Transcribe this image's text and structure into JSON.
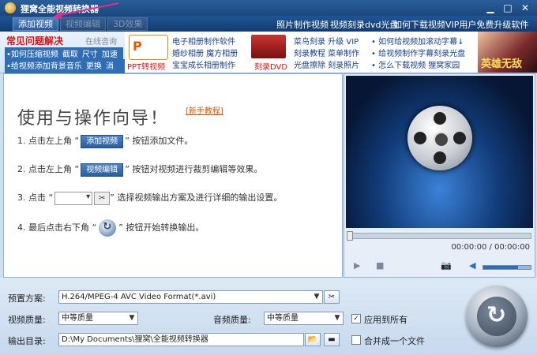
{
  "window": {
    "title": "狸窝全能视频转换器"
  },
  "toolbar": {
    "add_video": "添加视频",
    "edit_video": "视频编辑",
    "effect_3d": "3D效果",
    "links": [
      "照片制作视频",
      "视频刻录dvd光盘",
      "如何下载视频",
      "VIP用户免费升级软件"
    ]
  },
  "banner": {
    "faq_title": "常见问题解决",
    "online_ask": "在线咨询",
    "faq_line1": [
      "•如何压缩视频",
      "截取",
      "尺寸",
      "加速"
    ],
    "faq_line2": [
      "•给视频添加背景音乐",
      "更换",
      "消音"
    ],
    "ppt_icon_text": "P",
    "ppt_label": "PPT转视频",
    "col1": [
      "电子相册制作软件",
      "婚纱相册  魔方相册",
      "宝宝成长相册制作"
    ],
    "dvd_label": "刻录DVD",
    "col2": [
      "菜鸟刻录  升级 VIP",
      "刻录教程  菜单制作",
      "光盘擦除  刻录照片"
    ],
    "col3": [
      "• 如何给视频加滚动字幕↓",
      "• 给视频制作字幕刻录光盘",
      "• 怎么下载视频  狸窝家园"
    ],
    "ad_text": "英雄无敌"
  },
  "guide": {
    "heading": "使用与操作向导！",
    "new_tutorial": "[新手教程]",
    "step1_pre": "1. 点击左上角 “",
    "step1_btn": "添加视频",
    "step1_post": "” 按钮添加文件。",
    "step2_pre": "2. 点击左上角 “",
    "step2_btn": "视频编辑",
    "step2_post": "” 按钮对视频进行裁剪编辑等效果。",
    "step3_pre": "3. 点击 “",
    "step3_post": "” 选择视频输出方案及进行详细的输出设置。",
    "step4_pre": "4. 最后点击右下角 “",
    "step4_post": "” 按钮开始转换输出。"
  },
  "player": {
    "time": "00:00:00 / 00:00:00"
  },
  "settings": {
    "preset_label": "预置方案:",
    "preset_value": "H.264/MPEG-4 AVC Video Format(*.avi)",
    "video_quality_label": "视频质量:",
    "video_quality_value": "中等质量",
    "audio_quality_label": "音频质量:",
    "audio_quality_value": "中等质量",
    "apply_all_label": "应用到所有",
    "apply_all_checked": true,
    "output_label": "输出目录:",
    "output_value": "D:\\My Documents\\狸窝\\全能视频转换器",
    "merge_label": "合并成一个文件",
    "merge_checked": false
  }
}
